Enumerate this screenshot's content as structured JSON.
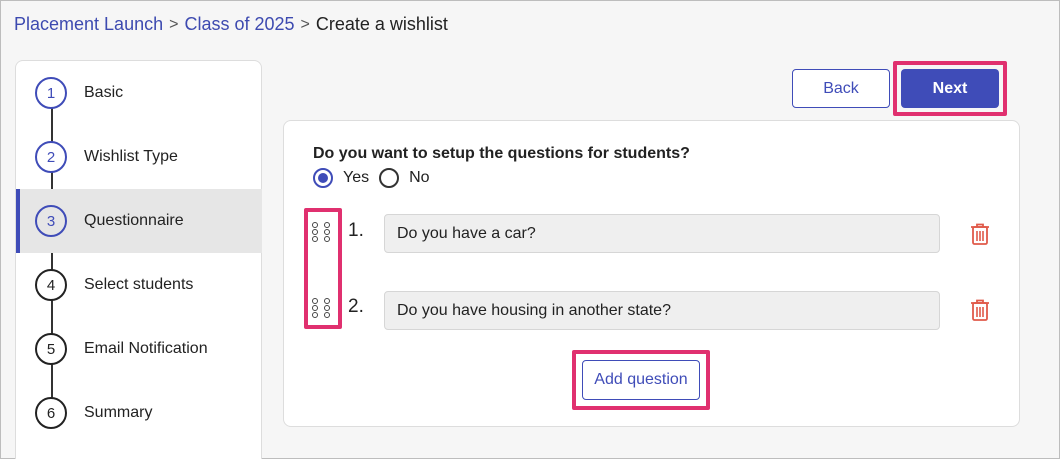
{
  "breadcrumb": {
    "items": [
      "Placement Launch",
      "Class of 2025"
    ],
    "current": "Create a wishlist",
    "separator": ">"
  },
  "stepper": {
    "steps": [
      {
        "number": "1",
        "label": "Basic"
      },
      {
        "number": "2",
        "label": "Wishlist Type"
      },
      {
        "number": "3",
        "label": "Questionnaire"
      },
      {
        "number": "4",
        "label": "Select students"
      },
      {
        "number": "5",
        "label": "Email Notification"
      },
      {
        "number": "6",
        "label": "Summary"
      }
    ]
  },
  "actions": {
    "back_label": "Back",
    "next_label": "Next"
  },
  "form": {
    "prompt": "Do you want to setup the questions for students?",
    "options": [
      "Yes",
      "No"
    ],
    "selected": "Yes",
    "questions": [
      {
        "number": "1.",
        "text": "Do you have a car?"
      },
      {
        "number": "2.",
        "text": "Do you have housing in another state?"
      }
    ],
    "add_label": "Add question"
  },
  "colors": {
    "accent": "#3f4cb8",
    "highlight": "#e0306f",
    "danger": "#e05a4a"
  }
}
